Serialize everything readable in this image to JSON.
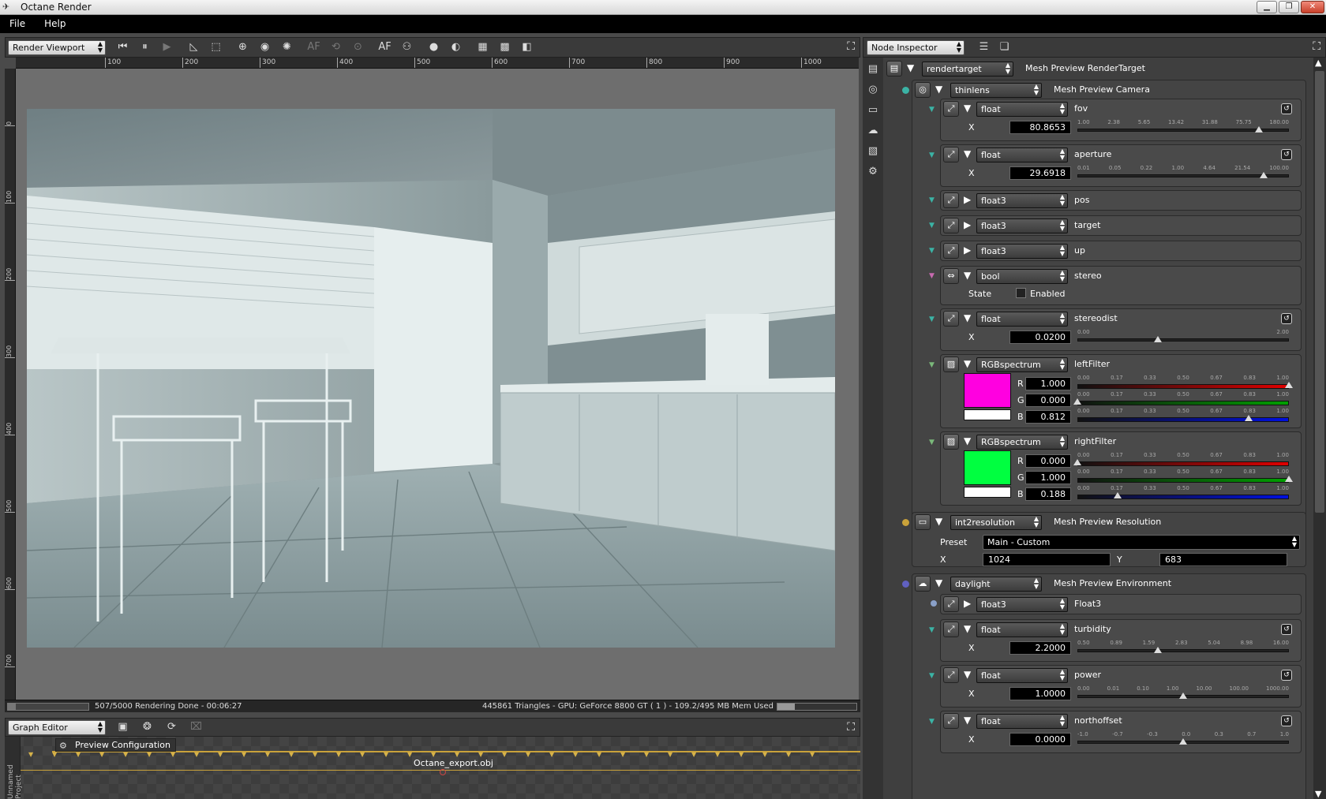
{
  "window": {
    "title": "Octane Render",
    "icon": "octane-logo-icon"
  },
  "menu": [
    "File",
    "Help"
  ],
  "viewport": {
    "panel_select": "Render Viewport",
    "ruler_x": [
      "100",
      "200",
      "300",
      "400",
      "500",
      "600",
      "700",
      "800",
      "900",
      "1000"
    ],
    "ruler_y": [
      "0",
      "100",
      "200",
      "300",
      "400",
      "500",
      "600",
      "700"
    ],
    "status_left": "507/5000 Rendering Done - 00:06:27",
    "status_right": "445861 Triangles - GPU: GeForce 8800 GT ( 1 ) - 109.2/495 MB Mem Used",
    "progress": 0.1014,
    "mem_fraction": 0.2206,
    "af_label": "AF",
    "af_dim_label": "AF"
  },
  "graph_editor": {
    "panel_select": "Graph Editor",
    "project_label": "Unnamed Project",
    "node_label": "Preview Configuration",
    "obj_label": "Octane_export.obj"
  },
  "inspector": {
    "panel_select": "Node Inspector",
    "rendertarget": {
      "type": "rendertarget",
      "name": "Mesh Preview RenderTarget"
    },
    "camera": {
      "type": "thinlens",
      "name": "Mesh Preview Camera"
    },
    "fov": {
      "type": "float",
      "name": "fov",
      "axis": "X",
      "value": "80.8653",
      "ticks": [
        "1.00",
        "2.38",
        "5.65",
        "13.42",
        "31.88",
        "75.75",
        "180.00"
      ],
      "pos": 0.86
    },
    "aperture": {
      "type": "float",
      "name": "aperture",
      "axis": "X",
      "value": "29.6918",
      "ticks": [
        "0.01",
        "0.05",
        "0.22",
        "1.00",
        "4.64",
        "21.54",
        "100.00"
      ],
      "pos": 0.88
    },
    "pos": {
      "type": "float3",
      "name": "pos"
    },
    "target": {
      "type": "float3",
      "name": "target"
    },
    "up": {
      "type": "float3",
      "name": "up"
    },
    "stereo": {
      "type": "bool",
      "name": "stereo",
      "state_label": "State",
      "enabled_label": "Enabled"
    },
    "stereodist": {
      "type": "float",
      "name": "stereodist",
      "axis": "X",
      "value": "0.0200",
      "ticks": [
        "0.00",
        "2.00"
      ],
      "pos": 0.38
    },
    "leftFilter": {
      "type": "RGBspectrum",
      "name": "leftFilter",
      "color": "#ff00e0",
      "r": "1.000",
      "g": "0.000",
      "b": "0.812",
      "rp": 1.0,
      "gp": 0.0,
      "bp": 0.81,
      "ticks": [
        "0.00",
        "0.17",
        "0.33",
        "0.50",
        "0.67",
        "0.83",
        "1.00"
      ]
    },
    "rightFilter": {
      "type": "RGBspectrum",
      "name": "rightFilter",
      "color": "#00ff40",
      "r": "0.000",
      "g": "1.000",
      "b": "0.188",
      "rp": 0.0,
      "gp": 1.0,
      "bp": 0.19,
      "ticks": [
        "0.00",
        "0.17",
        "0.33",
        "0.50",
        "0.67",
        "0.83",
        "1.00"
      ]
    },
    "rgb_labels": {
      "r": "R",
      "g": "G",
      "b": "B"
    },
    "resolution": {
      "type": "int2resolution",
      "name": "Mesh Preview Resolution",
      "preset_label": "Preset",
      "preset": "Main - Custom",
      "x_label": "X",
      "x": "1024",
      "y_label": "Y",
      "y": "683"
    },
    "environment": {
      "type": "daylight",
      "name": "Mesh Preview Environment"
    },
    "float3": {
      "type": "float3",
      "name": "Float3"
    },
    "turbidity": {
      "type": "float",
      "name": "turbidity",
      "axis": "X",
      "value": "2.2000",
      "ticks": [
        "0.50",
        "0.89",
        "1.59",
        "2.83",
        "5.04",
        "8.98",
        "16.00"
      ],
      "pos": 0.38
    },
    "power": {
      "type": "float",
      "name": "power",
      "axis": "X",
      "value": "1.0000",
      "ticks": [
        "0.00",
        "0.01",
        "0.10",
        "1.00",
        "10.00",
        "100.00",
        "1000.00"
      ],
      "pos": 0.5
    },
    "northoffset": {
      "type": "float",
      "name": "northoffset",
      "axis": "X",
      "value": "0.0000",
      "ticks": [
        "-1.0",
        "-0.7",
        "-0.3",
        "0.0",
        "0.3",
        "0.7",
        "1.0"
      ],
      "pos": 0.5
    }
  },
  "colors": {
    "accent_pin_yellow": "#c9a23a",
    "pin_cyan": "#3bb3a5",
    "pin_purple": "#6060c0"
  }
}
